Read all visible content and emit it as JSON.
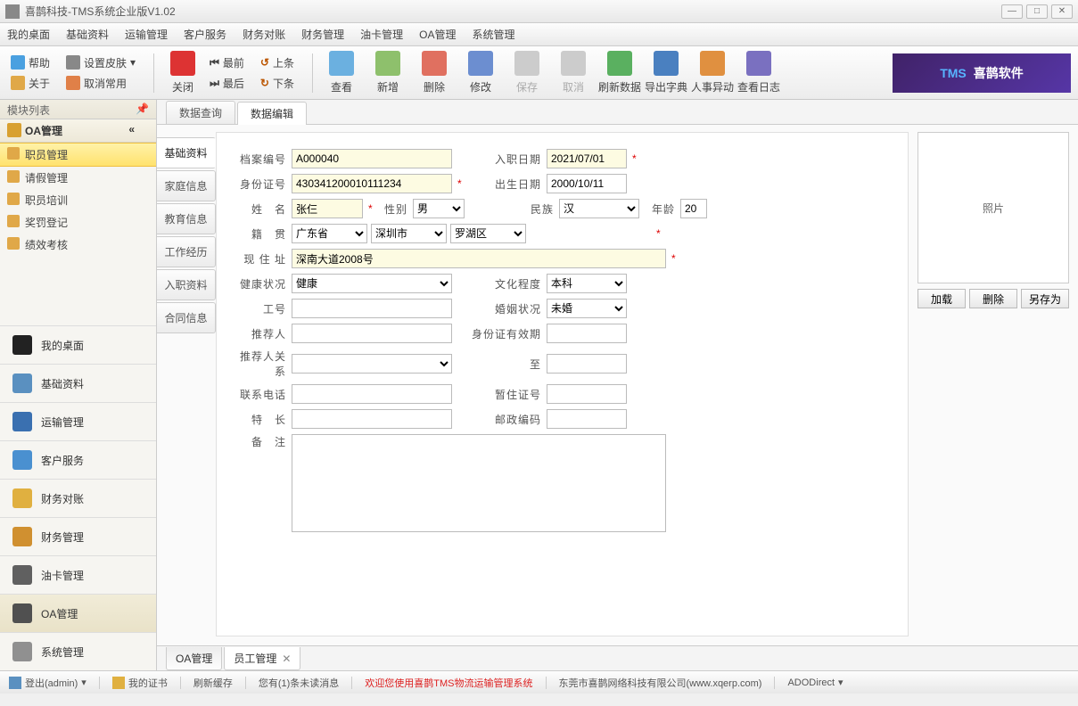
{
  "window": {
    "title": "喜鹊科技-TMS系统企业版V1.02"
  },
  "menubar": [
    "我的桌面",
    "基础资料",
    "运输管理",
    "客户服务",
    "财务对账",
    "财务管理",
    "油卡管理",
    "OA管理",
    "系统管理"
  ],
  "toolbar": {
    "help": "帮助",
    "skin": "设置皮肤",
    "about": "关于",
    "cancel_common": "取消常用",
    "close": "关闭",
    "first": "最前",
    "last": "最后",
    "prev": "上条",
    "next": "下条",
    "view": "查看",
    "add": "新增",
    "del": "删除",
    "edit": "修改",
    "save": "保存",
    "cancel": "取消",
    "refresh": "刷新数据",
    "export": "导出字典",
    "transfer": "人事异动",
    "log": "查看日志",
    "brand_tms": "TMS",
    "brand_name": "喜鹊软件"
  },
  "sidebar": {
    "header": "模块列表",
    "category": "OA管理",
    "tree": [
      "职员管理",
      "请假管理",
      "职员培训",
      "奖罚登记",
      "绩效考核"
    ],
    "activeTree": "职员管理",
    "nav": [
      "我的桌面",
      "基础资料",
      "运输管理",
      "客户服务",
      "财务对账",
      "财务管理",
      "油卡管理",
      "OA管理",
      "系统管理"
    ],
    "activeNav": "OA管理"
  },
  "tabs": {
    "query": "数据查询",
    "edit": "数据编辑"
  },
  "subtabs": [
    "基础资料",
    "家庭信息",
    "教育信息",
    "工作经历",
    "入职资料",
    "合同信息"
  ],
  "form": {
    "labels": {
      "file_no": "档案编号",
      "id_no": "身份证号",
      "name": "姓　名",
      "sex": "性别",
      "origin": "籍　贯",
      "address": "现 住 址",
      "health": "健康状况",
      "emp_no": "工号",
      "referrer": "推荐人",
      "ref_rel": "推荐人关系",
      "phone": "联系电话",
      "skill": "特　长",
      "remark": "备　注",
      "hiredate": "入职日期",
      "birthdate": "出生日期",
      "nation": "民族",
      "age": "年龄",
      "edu": "文化程度",
      "marriage": "婚姻状况",
      "id_valid": "身份证有效期",
      "to": "至",
      "temp_id": "暂住证号",
      "zip": "邮政编码"
    },
    "values": {
      "file_no": "A000040",
      "id_no": "430341200010111234",
      "name": "张仨",
      "sex": "男",
      "province": "广东省",
      "city": "深圳市",
      "district": "罗湖区",
      "address": "深南大道2008号",
      "health": "健康",
      "hiredate": "2021/07/01",
      "birthdate": "2000/10/11",
      "nation": "汉",
      "age": "20",
      "edu": "本科",
      "marriage": "未婚"
    },
    "photo": "照片",
    "photo_btns": {
      "load": "加载",
      "del": "删除",
      "saveas": "另存为"
    }
  },
  "bottomTabs": {
    "oa": "OA管理",
    "emp": "员工管理"
  },
  "statusbar": {
    "login": "登出(admin)",
    "cert": "我的证书",
    "refresh": "刷新缓存",
    "unread": "您有(1)条未读消息",
    "welcome": "欢迎您使用喜鹊TMS物流运输管理系统",
    "company": "东莞市喜鹊网络科技有限公司(www.xqerp.com)",
    "ado": "ADODirect"
  }
}
